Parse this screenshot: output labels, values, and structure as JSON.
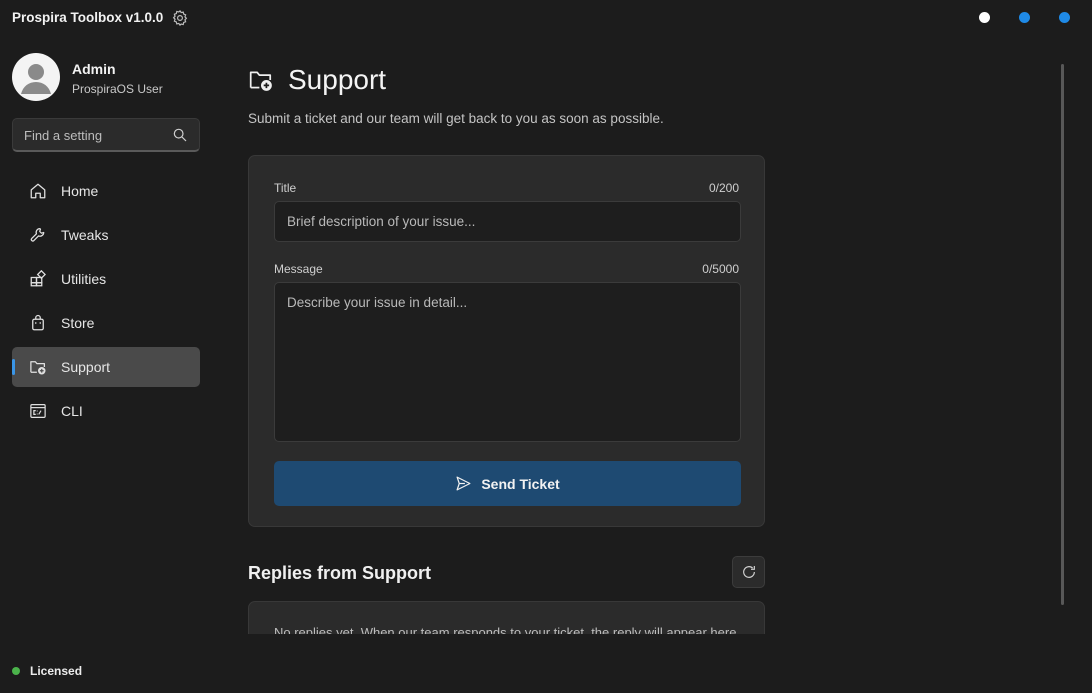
{
  "app": {
    "title": "Prospira Toolbox v1.0.0"
  },
  "profile": {
    "name": "Admin",
    "subtitle": "ProspiraOS User"
  },
  "search": {
    "placeholder": "Find a setting"
  },
  "sidebar": {
    "items": [
      {
        "label": "Home",
        "icon": "home-icon"
      },
      {
        "label": "Tweaks",
        "icon": "wrench-icon"
      },
      {
        "label": "Utilities",
        "icon": "grid-icon"
      },
      {
        "label": "Store",
        "icon": "shopping-bag-icon"
      },
      {
        "label": "Support",
        "icon": "folder-add-icon",
        "active": true
      },
      {
        "label": "CLI",
        "icon": "terminal-icon"
      }
    ]
  },
  "license": {
    "label": "Licensed",
    "color": "#4bb34b"
  },
  "page": {
    "title": "Support",
    "subtitle": "Submit a ticket and our team will get back to you as soon as possible."
  },
  "form": {
    "title_label": "Title",
    "title_count": "0/200",
    "title_placeholder": "Brief description of your issue...",
    "title_value": "",
    "message_label": "Message",
    "message_count": "0/5000",
    "message_placeholder": "Describe your issue in detail...",
    "message_value": "",
    "send_label": "Send Ticket"
  },
  "replies": {
    "title": "Replies from Support",
    "empty_text": "No replies yet. When our team responds to your ticket, the reply will appear here."
  },
  "colors": {
    "accent": "#3a95e6",
    "button": "#1e4a72",
    "background": "#1c1c1c",
    "card": "#2b2b2b"
  }
}
